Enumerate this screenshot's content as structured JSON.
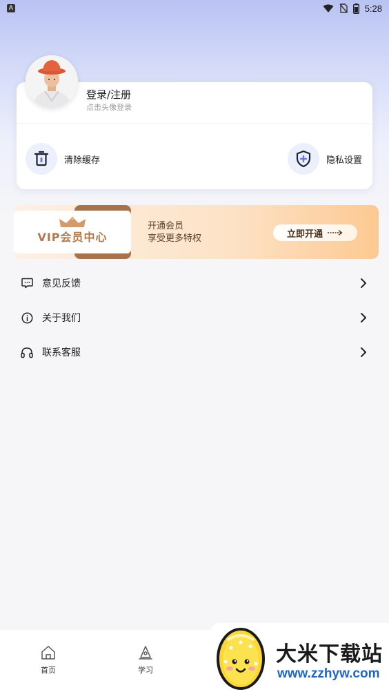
{
  "status_bar": {
    "time": "5:28",
    "indicator": "A"
  },
  "profile": {
    "title": "登录/注册",
    "subtitle": "点击头像登录"
  },
  "tools": [
    {
      "label": "清除缓存",
      "icon": "trash-icon"
    },
    {
      "label": "隐私设置",
      "icon": "shield-plus-icon"
    }
  ],
  "vip": {
    "name": "VIP会员中心",
    "line1": "开通会员",
    "line2": "享受更多特权",
    "button": "立即开通"
  },
  "menu": [
    {
      "label": "意见反馈",
      "icon": "feedback-icon"
    },
    {
      "label": "关于我们",
      "icon": "info-icon"
    },
    {
      "label": "联系客服",
      "icon": "headset-icon"
    }
  ],
  "nav": [
    {
      "label": "首页",
      "icon": "home-icon"
    },
    {
      "label": "学习",
      "icon": "study-icon"
    }
  ],
  "watermark": {
    "title": "大米下载站",
    "url": "www.zzhyw.com"
  },
  "colors": {
    "accent": "#b9c3f3",
    "vip_brown": "#a8734a",
    "vip_orange": "#fdc992",
    "url_blue": "#1e63c8"
  }
}
